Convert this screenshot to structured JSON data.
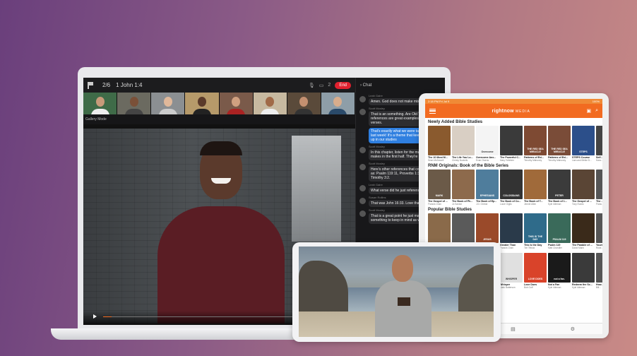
{
  "laptop": {
    "topbar": {
      "pager": "2/6",
      "passage": "1 John 1:4",
      "count": "2",
      "end_label": "End"
    },
    "gallery_label": "Gallery Mode",
    "chat": {
      "title": "Chat",
      "messages": [
        {
          "who": "Leah Gaire",
          "text": "Amen. God does not make mistakes"
        },
        {
          "who": "Scott Mosley",
          "text": "That is an something. Are Old Testament references are great examples for these verses."
        },
        {
          "who": "",
          "text": "That's exactly what we were talking about last week! It's a theme that keeps showing up in our studies",
          "me": true
        },
        {
          "who": "Scott Mosley",
          "text": "In this chapter, listen for the main points he makes in the first half. They're coming up."
        },
        {
          "who": "Scott Mosley",
          "text": "Here's other references that come to mind as: Psalm 119:11, Proverbs 1:3, and 1 Timothy 3:2."
        },
        {
          "who": "Leah Gaire",
          "text": "What verse did he just reference?"
        },
        {
          "who": "Susan Rollins",
          "text": "That was John 16:33. Love that!"
        },
        {
          "who": "Scott Mosley",
          "text": "That is a great point he just made! It's something to keep in mind as we..."
        }
      ],
      "time": "2:18pm"
    }
  },
  "tablet": {
    "status_left": "2:18 PM  Fri Jul 9",
    "status_right": "100%",
    "logo": "rightnow",
    "logo_sub": "MEDIA",
    "sections": [
      {
        "title": "Newly Added Bible Studies",
        "items": [
          {
            "name": "The 10 Most M...",
            "author": "Sean McDowell",
            "color": "#8a5a2e",
            "cover": ""
          },
          {
            "name": "The Life You Lo...",
            "author": "Christy Nockels",
            "color": "#d9cfc4",
            "cover": ""
          },
          {
            "name": "Overcome Anx...",
            "author": "Evan Owens",
            "color": "#f4f4f4",
            "cover": "Overcome"
          },
          {
            "name": "The Powerful C...",
            "author": "Mary Totleben",
            "color": "#3a3a3a",
            "cover": ""
          },
          {
            "name": "Patterns of Evi...",
            "author": "Timothy Mahoney",
            "color": "#7e4a33",
            "cover": "THE RED SEA MIRACLE"
          },
          {
            "name": "Patterns of Evi...",
            "author": "Timothy Mahoney",
            "color": "#7a4c38",
            "cover": "THE RED SEA MIRACLE"
          },
          {
            "name": "STEPS Course",
            "author": "Lara and Meike D...",
            "color": "#2c4f8a",
            "cover": "STEPS"
          },
          {
            "name": "Self...",
            "author": "Kara...",
            "color": "#444",
            "cover": ""
          }
        ]
      },
      {
        "title": "RNM Originals: Book of the Bible Series",
        "items": [
          {
            "name": "The Gospel of ...",
            "author": "Francis Chan",
            "color": "#6b5a48",
            "cover": "MARK"
          },
          {
            "name": "The Book of Ph...",
            "author": "Jo Saxton",
            "color": "#8d6a4c",
            "cover": ""
          },
          {
            "name": "The Book of Ep...",
            "author": "J.D. Greear",
            "color": "#4f7d9c",
            "cover": "EPHESIANS"
          },
          {
            "name": "The Book of Co...",
            "author": "Louie Giglio",
            "color": "#333",
            "cover": "COLOSSIANS"
          },
          {
            "name": "The Book of T...",
            "author": "Jennie Allen",
            "color": "#a06a3a",
            "cover": ""
          },
          {
            "name": "The Book of 1...",
            "author": "Kyle Idleman",
            "color": "#3b3b3b",
            "cover": "PETER"
          },
          {
            "name": "The Gospel of ...",
            "author": "Tony Evans",
            "color": "#5a4535",
            "cover": ""
          },
          {
            "name": "The ...",
            "author": "Franc...",
            "color": "#555",
            "cover": ""
          }
        ]
      },
      {
        "title": "Popular Bible Studies",
        "items": [
          {
            "name": "",
            "author": "",
            "color": "#8a6a4a",
            "cover": ""
          },
          {
            "name": "",
            "author": "",
            "color": "#5a5a5a",
            "cover": ""
          },
          {
            "name": "",
            "author": "",
            "color": "#9a4a2a",
            "cover": "JESUS"
          },
          {
            "name": "Greater Than",
            "author": "Francis Chan",
            "color": "#2a3a4a",
            "cover": ""
          },
          {
            "name": "This Is the Day",
            "author": "Tim Tebow",
            "color": "#2f6b8a",
            "cover": "THIS IS THE DAY"
          },
          {
            "name": "Psalm 119",
            "author": "Matt Chandler",
            "color": "#3a6a5a",
            "cover": "PSALM 119"
          },
          {
            "name": "The Parable of ...",
            "author": "David Mann",
            "color": "#3a2a1a",
            "cover": ""
          },
          {
            "name": "Yours...",
            "author": "Rose...",
            "color": "#555",
            "cover": ""
          }
        ]
      },
      {
        "title": "",
        "items": [
          {
            "name": "",
            "author": "",
            "color": "#888",
            "cover": ""
          },
          {
            "name": "",
            "author": "",
            "color": "#999",
            "cover": ""
          },
          {
            "name": "",
            "author": "",
            "color": "#777",
            "cover": ""
          },
          {
            "name": "Whisper",
            "author": "Mark Batterson",
            "color": "#e0e0e0",
            "cover": "WHISPER"
          },
          {
            "name": "Love Does",
            "author": "Bob Goff",
            "color": "#d9432a",
            "cover": "LOVE DOES"
          },
          {
            "name": "Not a Fan",
            "author": "Kyle Idleman",
            "color": "#1a1a1a",
            "cover": "not a fan."
          },
          {
            "name": "Redeem the Sc...",
            "author": "Kyle Idleman",
            "color": "#3a3a3a",
            "cover": ""
          },
          {
            "name": "How...",
            "author": "Bill...",
            "color": "#555",
            "cover": ""
          }
        ]
      }
    ]
  }
}
